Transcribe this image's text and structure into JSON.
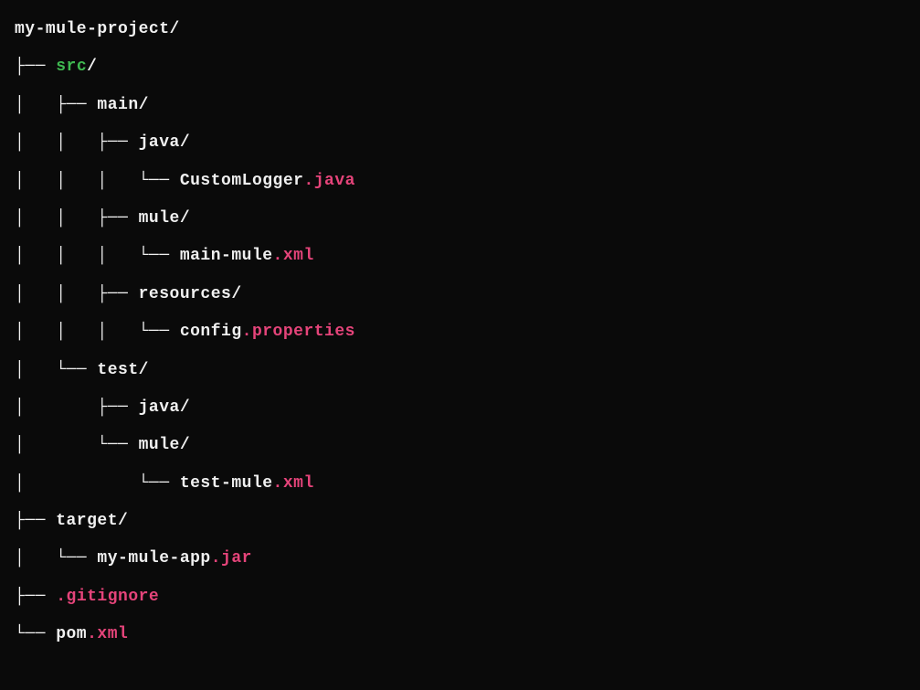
{
  "lines": [
    {
      "segments": [
        {
          "text": "my-mule-project/",
          "color": "white"
        }
      ]
    },
    {
      "segments": [
        {
          "text": "├── ",
          "color": "white"
        },
        {
          "text": "src",
          "color": "green"
        },
        {
          "text": "/",
          "color": "white"
        }
      ]
    },
    {
      "segments": [
        {
          "text": "│   ├── main/",
          "color": "white"
        }
      ]
    },
    {
      "segments": [
        {
          "text": "│   │   ├── java/",
          "color": "white"
        }
      ]
    },
    {
      "segments": [
        {
          "text": "│   │   │   └── CustomLogger",
          "color": "white"
        },
        {
          "text": ".java",
          "color": "pink"
        }
      ]
    },
    {
      "segments": [
        {
          "text": "│   │   ├── mule/",
          "color": "white"
        }
      ]
    },
    {
      "segments": [
        {
          "text": "│   │   │   └── main-mule",
          "color": "white"
        },
        {
          "text": ".xml",
          "color": "pink"
        }
      ]
    },
    {
      "segments": [
        {
          "text": "│   │   ├── resources/",
          "color": "white"
        }
      ]
    },
    {
      "segments": [
        {
          "text": "│   │   │   └── config",
          "color": "white"
        },
        {
          "text": ".properties",
          "color": "pink"
        }
      ]
    },
    {
      "segments": [
        {
          "text": "│   └── test/",
          "color": "white"
        }
      ]
    },
    {
      "segments": [
        {
          "text": "│       ├── java/",
          "color": "white"
        }
      ]
    },
    {
      "segments": [
        {
          "text": "│       └── mule/",
          "color": "white"
        }
      ]
    },
    {
      "segments": [
        {
          "text": "│           └── test-mule",
          "color": "white"
        },
        {
          "text": ".xml",
          "color": "pink"
        }
      ]
    },
    {
      "segments": [
        {
          "text": "├── target/",
          "color": "white"
        }
      ]
    },
    {
      "segments": [
        {
          "text": "│   └── my-mule-app",
          "color": "white"
        },
        {
          "text": ".jar",
          "color": "pink"
        }
      ]
    },
    {
      "segments": [
        {
          "text": "├── ",
          "color": "white"
        },
        {
          "text": ".gitignore",
          "color": "pink"
        }
      ]
    },
    {
      "segments": [
        {
          "text": "└── pom",
          "color": "white"
        },
        {
          "text": ".xml",
          "color": "pink"
        }
      ]
    }
  ]
}
